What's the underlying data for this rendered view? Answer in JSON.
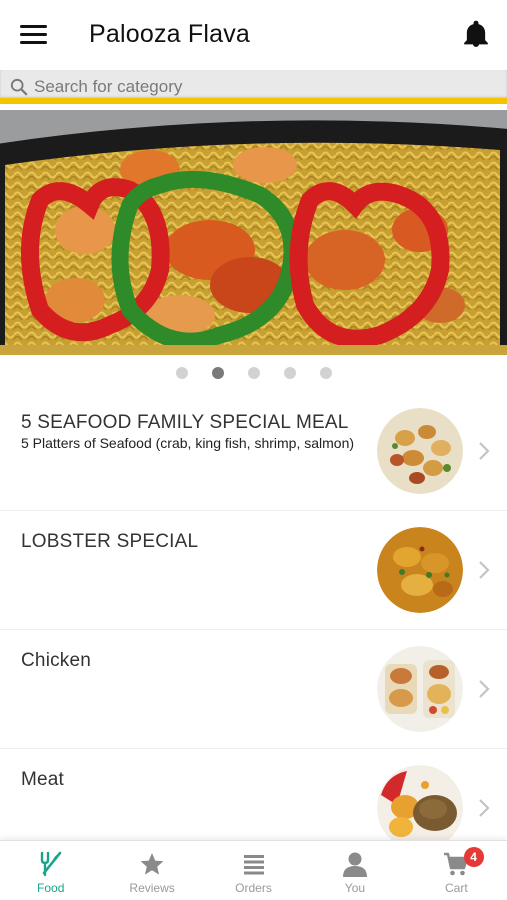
{
  "header": {
    "title": "Palooza Flava",
    "menu_icon": "hamburger-menu-icon",
    "notification_icon": "bell-icon"
  },
  "search": {
    "placeholder": "Search for category",
    "icon": "search-icon",
    "accent_color": "#f4c400"
  },
  "carousel": {
    "slide_count": 5,
    "active_index": 1
  },
  "categories": [
    {
      "title": "5 SEAFOOD FAMILY SPECIAL MEAL",
      "subtitle": "5 Platters of Seafood (crab, king fish, shrimp, salmon)"
    },
    {
      "title": "LOBSTER SPECIAL",
      "subtitle": ""
    },
    {
      "title": "Chicken",
      "subtitle": ""
    },
    {
      "title": "Meat",
      "subtitle": ""
    }
  ],
  "bottom_nav": {
    "active_color": "#1aa58a",
    "items": [
      {
        "label": "Food",
        "icon": "fork-knife-icon"
      },
      {
        "label": "Reviews",
        "icon": "star-icon"
      },
      {
        "label": "Orders",
        "icon": "list-icon"
      },
      {
        "label": "You",
        "icon": "person-icon"
      },
      {
        "label": "Cart",
        "icon": "cart-icon",
        "badge": "4"
      }
    ]
  }
}
